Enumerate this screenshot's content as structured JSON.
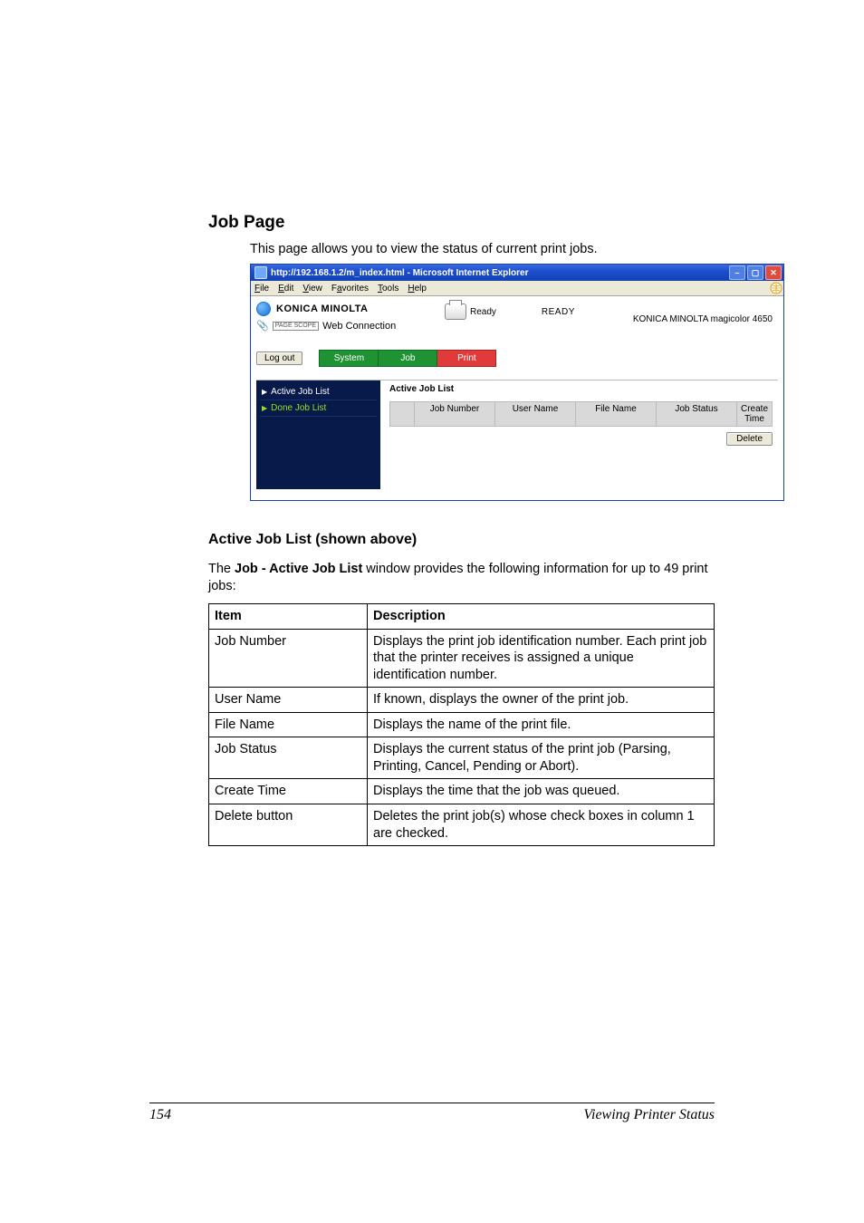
{
  "doc": {
    "section_title": "Job Page",
    "intro": "This page allows you to view the status of current print jobs.",
    "subsection_title": "Active Job List (shown above)",
    "sub_intro_pre": "The ",
    "sub_intro_bold": "Job - Active Job List",
    "sub_intro_post": " window provides the following information for up to 49 print jobs:",
    "table": {
      "head_item": "Item",
      "head_desc": "Description",
      "rows": [
        {
          "item": "Job Number",
          "desc": "Displays the print job identification number. Each print job that the printer receives is assigned a unique identification number."
        },
        {
          "item": "User Name",
          "desc": "If known, displays the owner of the print job."
        },
        {
          "item": "File Name",
          "desc": "Displays the name of the print file."
        },
        {
          "item": "Job Status",
          "desc": "Displays the current status of the print job (Parsing, Printing, Cancel, Pending or Abort)."
        },
        {
          "item": "Create Time",
          "desc": "Displays the time that the job was queued."
        },
        {
          "item": "Delete button",
          "desc": "Deletes the print job(s) whose check boxes in column 1 are checked."
        }
      ]
    },
    "footer_page": "154",
    "footer_title": "Viewing Printer Status"
  },
  "ie": {
    "title": "http://192.168.1.2/m_index.html - Microsoft Internet Explorer",
    "menu": {
      "file": "File",
      "edit": "Edit",
      "view": "View",
      "favorites": "Favorites",
      "tools": "Tools",
      "help": "Help"
    },
    "header": {
      "brand": "KONICA MINOLTA",
      "pagescope": "Web Connection",
      "pagescope_badge": "PAGE\nSCOPE",
      "ready_small": "Ready",
      "ready_big": "READY",
      "model": "KONICA MINOLTA magicolor 4650"
    },
    "logout": "Log out",
    "tabs": {
      "system": "System",
      "job": "Job",
      "print": "Print"
    },
    "sidebar": {
      "active": "Active Job List",
      "done": "Done Job List"
    },
    "main": {
      "title": "Active Job List",
      "cols": {
        "jobno": "Job Number",
        "user": "User Name",
        "file": "File Name",
        "status": "Job Status",
        "create": "Create Time"
      },
      "delete": "Delete"
    }
  }
}
